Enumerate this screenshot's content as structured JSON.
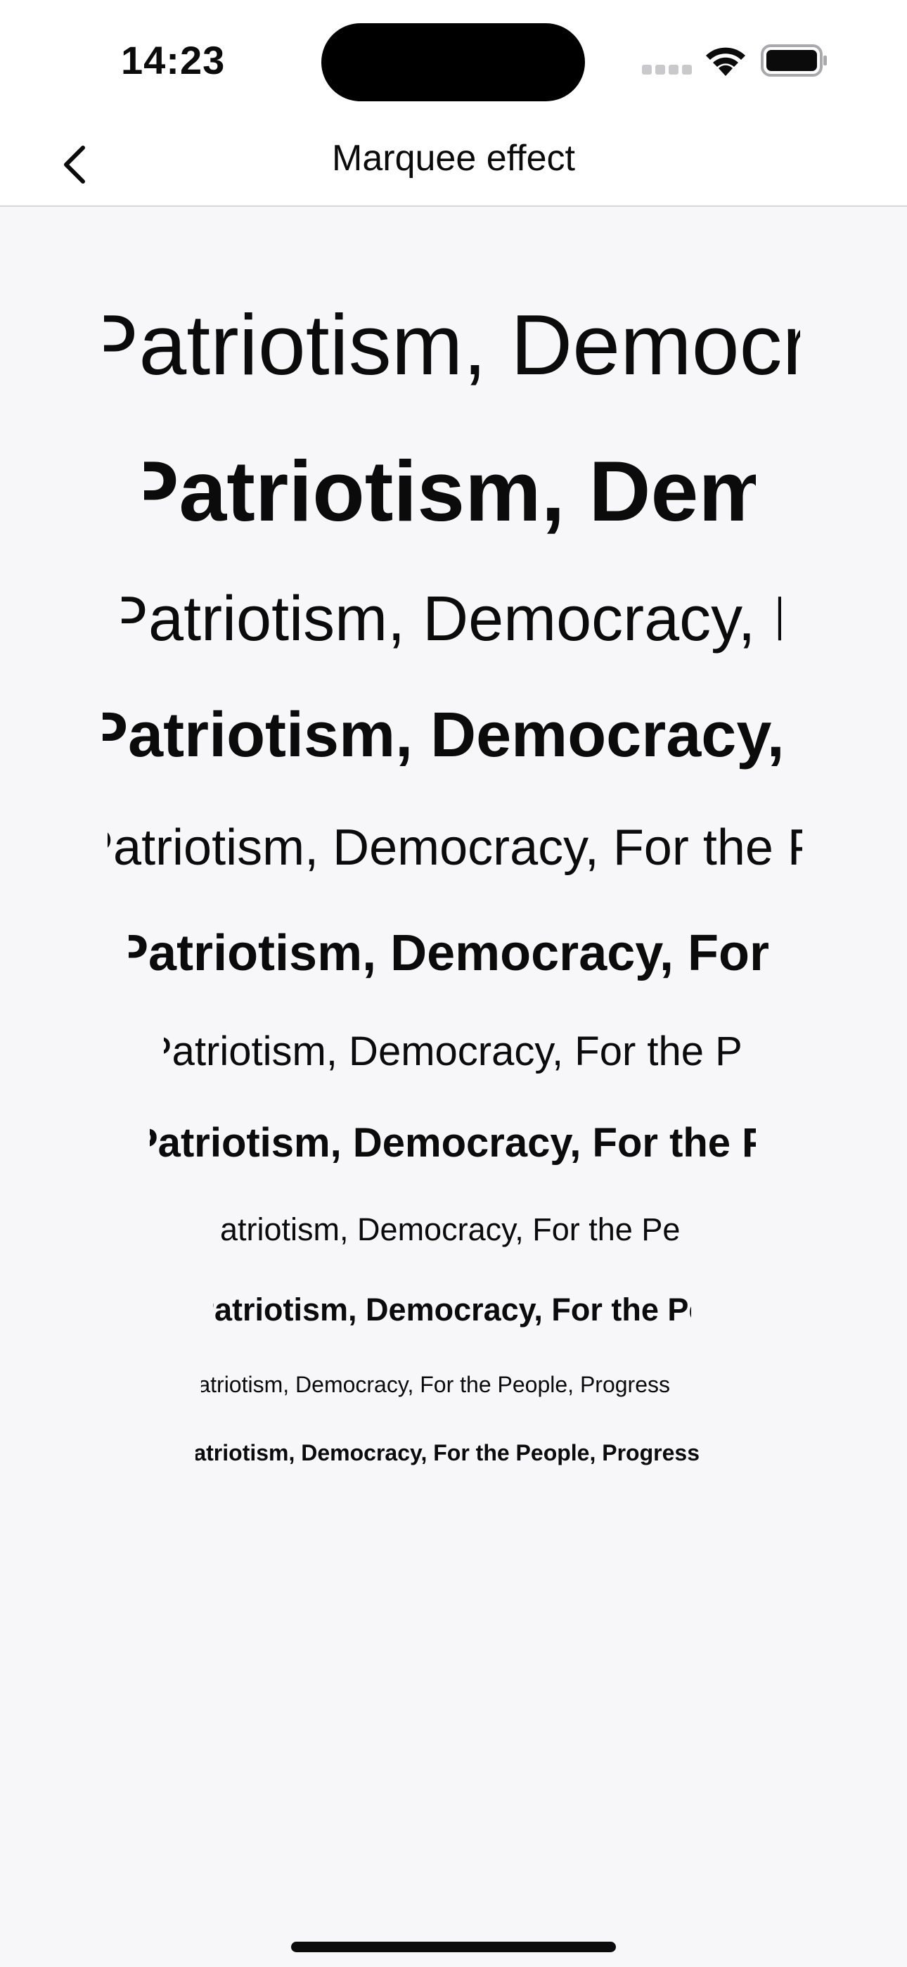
{
  "status_bar": {
    "time": "14:23"
  },
  "nav": {
    "title": "Marquee effect",
    "back_icon": "chevron-left-icon"
  },
  "marquee": {
    "rows": [
      {
        "text": "Patriotism, Democracy, For the People, Progress",
        "weight": "regular"
      },
      {
        "text": "Patriotism, Democracy, For the People, Progress",
        "weight": "bold"
      },
      {
        "text": "Patriotism, Democracy, For the People, Progress",
        "weight": "regular"
      },
      {
        "text": "Patriotism, Democracy, For the People, Progress",
        "weight": "bold"
      },
      {
        "text": "Patriotism, Democracy, For the People, Progress",
        "weight": "regular"
      },
      {
        "text": "Patriotism, Democracy, For the People, Progress",
        "weight": "bold"
      },
      {
        "text": "Patriotism, Democracy, For the People, Progress",
        "weight": "regular"
      },
      {
        "text": "Patriotism, Democracy, For the People, Progress",
        "weight": "bold"
      },
      {
        "text": "Patriotism, Democracy, For the People, Progress",
        "weight": "regular"
      },
      {
        "text": "Patriotism, Democracy, For the People, Progress",
        "weight": "bold"
      },
      {
        "text": "Patriotism, Democracy, For the People, Progress",
        "weight": "regular"
      },
      {
        "text": "Patriotism, Democracy, For the People, Progress",
        "weight": "bold"
      }
    ]
  },
  "colors": {
    "background": "#f7f7f9",
    "bar_background": "#ffffff",
    "text": "#0b0b0b"
  }
}
